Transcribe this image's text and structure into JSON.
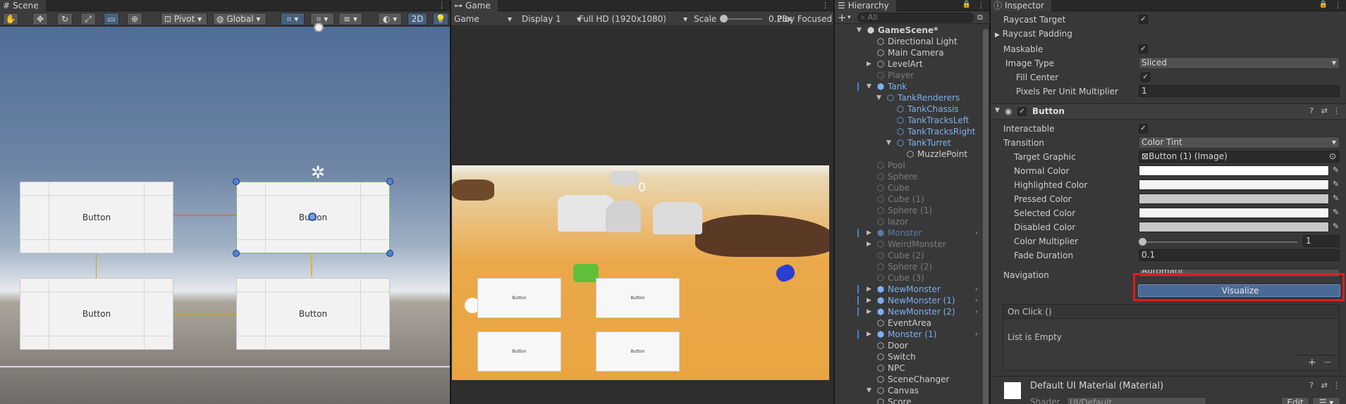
{
  "scene": {
    "tab": "Scene",
    "pivot": "Pivot",
    "global": "Global",
    "toggle_2d": "2D",
    "buttons": [
      "Button",
      "Button",
      "Button",
      "Button"
    ]
  },
  "game": {
    "tab": "Game",
    "view_mode": "Game",
    "display": "Display 1",
    "resolution": "Full HD (1920x1080)",
    "scale_label": "Scale",
    "scale_value": "0.28x",
    "play_focused": "Play Focused",
    "score": "0",
    "buttons": [
      "Button",
      "Button",
      "Button",
      "Button"
    ]
  },
  "hierarchy": {
    "tab": "Hierarchy",
    "add": "+",
    "search_placeholder": "All",
    "items": [
      {
        "label": "GameScene*",
        "icon": "unity-logo-icon"
      },
      {
        "label": "Directional Light",
        "icon": "cube-icon"
      },
      {
        "label": "Main Camera",
        "icon": "cube-icon"
      },
      {
        "label": "LevelArt",
        "icon": "cube-icon"
      },
      {
        "label": "Player",
        "icon": "cube-icon"
      },
      {
        "label": "Tank",
        "icon": "prefab-icon"
      },
      {
        "label": "TankRenderers",
        "icon": "cube-icon"
      },
      {
        "label": "TankChassis",
        "icon": "cube-icon"
      },
      {
        "label": "TankTracksLeft",
        "icon": "cube-icon"
      },
      {
        "label": "TankTracksRight",
        "icon": "cube-icon"
      },
      {
        "label": "TankTurret",
        "icon": "cube-icon"
      },
      {
        "label": "MuzzlePoint",
        "icon": "cube-icon"
      },
      {
        "label": "Pool",
        "icon": "cube-icon"
      },
      {
        "label": "Sphere",
        "icon": "cube-icon"
      },
      {
        "label": "Cube",
        "icon": "cube-icon"
      },
      {
        "label": "Cube (1)",
        "icon": "cube-icon"
      },
      {
        "label": "Sphere (1)",
        "icon": "cube-icon"
      },
      {
        "label": "lazor",
        "icon": "cube-icon"
      },
      {
        "label": "Monster",
        "icon": "prefab-icon"
      },
      {
        "label": "WeirdMonster",
        "icon": "cube-icon"
      },
      {
        "label": "Cube (2)",
        "icon": "cube-icon"
      },
      {
        "label": "Sphere (2)",
        "icon": "cube-icon"
      },
      {
        "label": "Cube (3)",
        "icon": "cube-icon"
      },
      {
        "label": "NewMonster",
        "icon": "prefab-icon"
      },
      {
        "label": "NewMonster (1)",
        "icon": "prefab-icon"
      },
      {
        "label": "NewMonster (2)",
        "icon": "prefab-icon"
      },
      {
        "label": "EventArea",
        "icon": "cube-icon"
      },
      {
        "label": "Monster (1)",
        "icon": "prefab-icon"
      },
      {
        "label": "Door",
        "icon": "cube-icon"
      },
      {
        "label": "Switch",
        "icon": "cube-icon"
      },
      {
        "label": "NPC",
        "icon": "cube-icon"
      },
      {
        "label": "SceneChanger",
        "icon": "cube-icon"
      },
      {
        "label": "Canvas",
        "icon": "cube-icon"
      },
      {
        "label": "Score",
        "icon": "cube-icon"
      }
    ]
  },
  "inspector": {
    "tab": "Inspector",
    "raycast_target": "Raycast Target",
    "raycast_padding": "Raycast Padding",
    "maskable": "Maskable",
    "image_type_label": "Image Type",
    "image_type_value": "Sliced",
    "fill_center": "Fill Center",
    "ppu_label": "Pixels Per Unit Multiplier",
    "ppu_value": "1",
    "component_title": "Button",
    "interactable": "Interactable",
    "transition_label": "Transition",
    "transition_value": "Color Tint",
    "target_graphic_label": "Target Graphic",
    "target_graphic_value": "Button (1) (Image)",
    "normal_color": "Normal Color",
    "highlighted_color": "Highlighted Color",
    "pressed_color": "Pressed Color",
    "selected_color": "Selected Color",
    "disabled_color": "Disabled Color",
    "color_multiplier_label": "Color Multiplier",
    "color_multiplier_value": "1",
    "fade_duration_label": "Fade Duration",
    "fade_duration_value": "0.1",
    "navigation_label": "Navigation",
    "navigation_value": "Automatic",
    "visualize": "Visualize",
    "onclick_header": "On Click ()",
    "list_empty": "List is Empty",
    "add_symbol": "+",
    "remove_symbol": "−",
    "material_name": "Default UI Material (Material)",
    "shader_label": "Shader",
    "shader_value": "UI/Default",
    "edit": "Edit"
  },
  "colors": {
    "highlight_red": "#e01b1b",
    "visualize_fill": "#4a6a96",
    "selection_blue": "#3d86d8"
  }
}
